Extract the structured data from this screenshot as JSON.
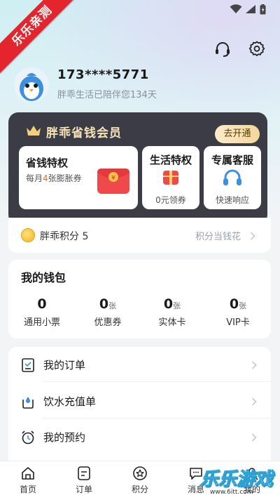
{
  "watermark": {
    "ribbon": "乐乐亲测",
    "brand": "乐乐游戏",
    "url": "www.6itt.com"
  },
  "header_icons": [
    "headset-icon",
    "gear-icon"
  ],
  "profile": {
    "phone": "173****5771",
    "subtitle": "胖乖生活已陪伴您134天"
  },
  "member": {
    "title": "胖乖省钱会员",
    "open_label": "去开通",
    "tile_save": {
      "title": "省钱特权",
      "desc_prefix": "每月",
      "desc_num": "4",
      "desc_suffix": "张膨胀券"
    },
    "tile_life": {
      "title": "生活特权",
      "desc": "0元领券"
    },
    "tile_service": {
      "title": "专属客服",
      "desc": "快速响应"
    }
  },
  "points": {
    "label": "胖乖积分 5",
    "tip": "积分当钱花"
  },
  "wallet": {
    "title": "我的钱包",
    "items": [
      {
        "num": "0",
        "unit": "",
        "label": "通用小票"
      },
      {
        "num": "0",
        "unit": "张",
        "label": "优惠券"
      },
      {
        "num": "0",
        "unit": "张",
        "label": "实体卡"
      },
      {
        "num": "0",
        "unit": "张",
        "label": "VIP卡"
      }
    ]
  },
  "menu": [
    {
      "label": "我的订单",
      "icon": "order-list-icon"
    },
    {
      "label": "饮水充值单",
      "icon": "water-drop-icon"
    },
    {
      "label": "我的预约",
      "icon": "alarm-clock-icon"
    }
  ],
  "nav": [
    {
      "label": "首页",
      "icon": "home-icon"
    },
    {
      "label": "订单",
      "icon": "order-icon"
    },
    {
      "label": "积分",
      "icon": "star-icon"
    },
    {
      "label": "消息",
      "icon": "message-icon"
    },
    {
      "label": "我的",
      "icon": "profile-icon"
    }
  ],
  "colors": {
    "accent": "#f1682c",
    "card_dark": "#3b3c46",
    "gold": "#f8e3b8"
  }
}
